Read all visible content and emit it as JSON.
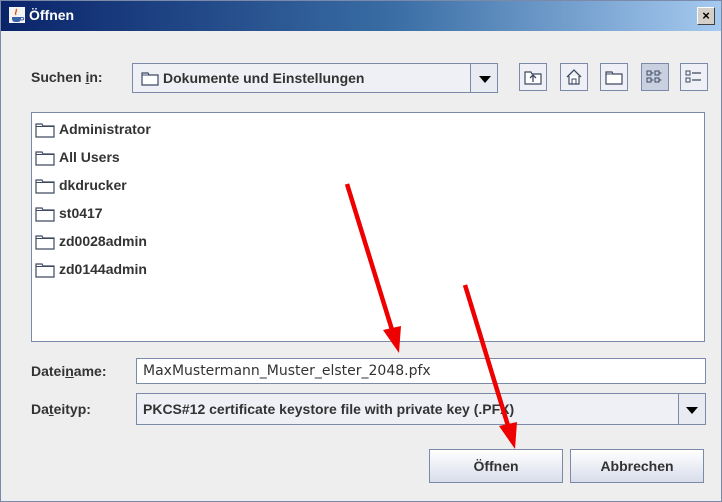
{
  "window": {
    "title": "Öffnen",
    "close_glyph": "×"
  },
  "look_in": {
    "label_pre": "Suchen ",
    "label_u": "i",
    "label_post": "n:",
    "value": "Dokumente und Einstellungen"
  },
  "toolbar": {
    "icons": [
      "up-one-level-icon",
      "home-icon",
      "new-folder-icon",
      "list-view-icon",
      "details-view-icon"
    ]
  },
  "files": [
    {
      "name": "Administrator"
    },
    {
      "name": "All Users"
    },
    {
      "name": "dkdrucker"
    },
    {
      "name": "st0417"
    },
    {
      "name": "zd0028admin"
    },
    {
      "name": "zd0144admin"
    }
  ],
  "filename": {
    "label_pre": "Datei",
    "label_u": "n",
    "label_post": "ame:",
    "value": "MaxMustermann_Muster_elster_2048.pfx"
  },
  "filetype": {
    "label_pre": "Da",
    "label_u": "t",
    "label_post": "eityp:",
    "value": "PKCS#12 certificate keystore file with private key (.PFX)"
  },
  "buttons": {
    "open": "Öffnen",
    "cancel": "Abbrechen"
  },
  "colors": {
    "annotation_arrow": "#ee0000",
    "titlebar_start": "#0a246a",
    "titlebar_end": "#a6caf0"
  }
}
